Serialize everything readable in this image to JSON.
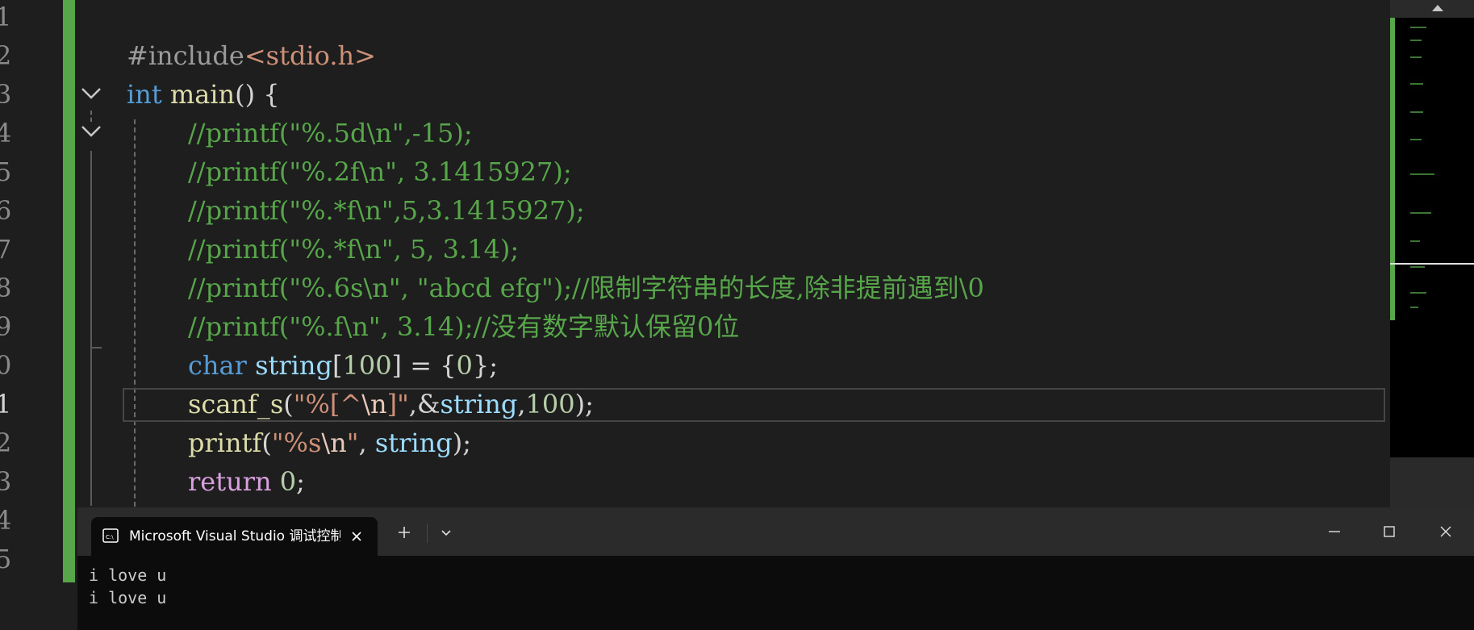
{
  "editor": {
    "line_numbers": [
      "1",
      "2",
      "3",
      "4",
      "5",
      "6",
      "7",
      "8",
      "9",
      "0",
      "1",
      "2",
      "3",
      "4",
      "5"
    ],
    "active_line_index": 10,
    "lines": [
      [],
      [
        [
          "pre",
          "#include"
        ],
        [
          "str",
          "<stdio.h>"
        ]
      ],
      [
        [
          "kw",
          "int"
        ],
        [
          "punc",
          " "
        ],
        [
          "fn",
          "main"
        ],
        [
          "punc",
          "() {"
        ]
      ],
      [
        [
          "cm",
          "//printf(\"%.5d\\n\",-15);"
        ]
      ],
      [
        [
          "cm",
          "//printf(\"%.2f\\n\", 3.1415927);"
        ]
      ],
      [
        [
          "cm",
          "//printf(\"%.*f\\n\",5,3.1415927);"
        ]
      ],
      [
        [
          "cm",
          "//printf(\"%.*f\\n\", 5, 3.14);"
        ]
      ],
      [
        [
          "cm",
          "//printf(\"%.6s\\n\", \"abcd efg\");//限制字符串的长度,除非提前遇到\\0"
        ]
      ],
      [
        [
          "cm",
          "//printf(\"%.f\\n\", 3.14);//没有数字默认保留0位"
        ]
      ],
      [
        [
          "kw",
          "char"
        ],
        [
          "punc",
          " "
        ],
        [
          "var",
          "string"
        ],
        [
          "punc",
          "["
        ],
        [
          "num",
          "100"
        ],
        [
          "punc",
          "] = {"
        ],
        [
          "num",
          "0"
        ],
        [
          "punc",
          "};"
        ]
      ],
      [
        [
          "fn",
          "scanf_s"
        ],
        [
          "punc",
          "("
        ],
        [
          "str",
          "\"%[^"
        ],
        [
          "esc",
          "\\n"
        ],
        [
          "str",
          "]\""
        ],
        [
          "punc",
          ",&"
        ],
        [
          "var",
          "string"
        ],
        [
          "punc",
          ","
        ],
        [
          "num",
          "100"
        ],
        [
          "punc",
          ");"
        ]
      ],
      [
        [
          "fn",
          "printf"
        ],
        [
          "punc",
          "("
        ],
        [
          "str",
          "\"%s"
        ],
        [
          "esc",
          "\\n"
        ],
        [
          "str",
          "\""
        ],
        [
          "punc",
          ", "
        ],
        [
          "var",
          "string"
        ],
        [
          "punc",
          ");"
        ]
      ],
      [
        [
          "ctl",
          "return"
        ],
        [
          "punc",
          " "
        ],
        [
          "num",
          "0"
        ],
        [
          "punc",
          ";"
        ]
      ],
      [],
      []
    ]
  },
  "terminal": {
    "tab_title": "Microsoft Visual Studio 调试控制台",
    "output": [
      "i love u",
      "i love u"
    ]
  },
  "colors": {
    "background": "#1e1e1e",
    "change_bar": "#57a64a",
    "comment": "#57a64a",
    "keyword": "#569cd6",
    "function": "#dcdcaa",
    "string": "#ce9178",
    "number": "#b5cea8",
    "variable": "#9cdcfe",
    "control": "#d8a0df"
  },
  "icons": {
    "tab_icon": "terminal-icon",
    "tab_close": "close-icon",
    "new_tab": "plus-icon",
    "dropdown": "chevron-down-icon",
    "minimize": "minimize-icon",
    "maximize": "maximize-icon",
    "close_window": "close-icon",
    "fold": "chevron-down-icon"
  }
}
